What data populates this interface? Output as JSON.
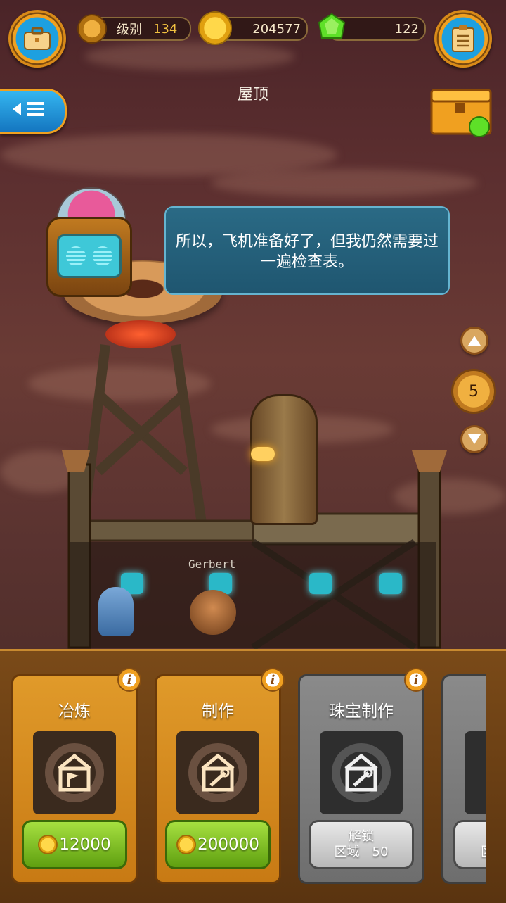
{
  "hud": {
    "level_label": "级别",
    "level_value": "134",
    "coins": "204577",
    "gems": "122"
  },
  "location_title": "屋顶",
  "dialog_text": "所以，飞机准备好了，但我仍然需要过一遍检查表。",
  "floor_number": "5",
  "npc_name": "Gerbert",
  "workshops": [
    {
      "title": "冶炼",
      "price": "12000",
      "locked": false,
      "icon": "anvil-flag-icon"
    },
    {
      "title": "制作",
      "price": "200000",
      "locked": false,
      "icon": "wrench-icon"
    },
    {
      "title": "珠宝制作",
      "unlock_label": "解锁",
      "unlock_req": "区域　50",
      "locked": true,
      "icon": "wrench-icon"
    },
    {
      "title": "",
      "unlock_label": "",
      "unlock_req": "区",
      "locked": true,
      "icon": "house-icon"
    }
  ],
  "colors": {
    "accent_orange": "#e09a2a",
    "button_blue": "#1da0e0",
    "button_green": "#6fb018",
    "gem_green": "#5ee028"
  }
}
